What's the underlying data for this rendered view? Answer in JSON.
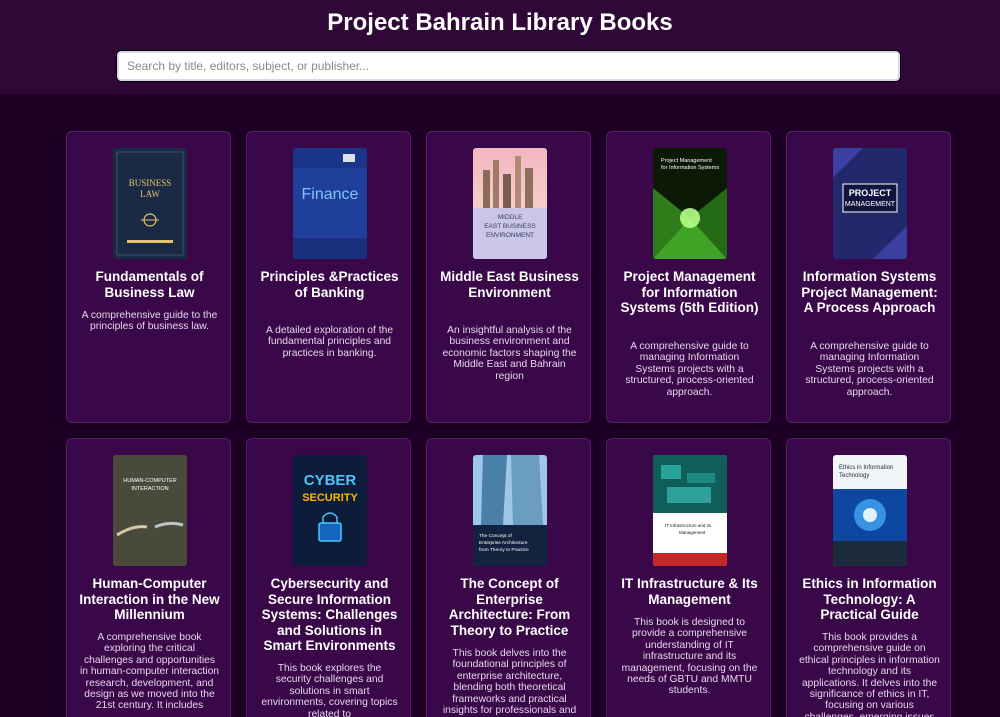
{
  "header": {
    "title": "Project Bahrain Library Books",
    "search_placeholder": "Search by title, editors, subject, or publisher..."
  },
  "books": [
    {
      "title": "Fundamentals of Business Law",
      "description": "A comprehensive guide to the principles of business law.",
      "cover_icon": "business-law-cover",
      "cover_text": [
        "BUSINESS",
        "LAW"
      ]
    },
    {
      "title": "Principles &Practices of Banking",
      "description": "A detailed exploration of the fundamental principles and practices in banking.",
      "cover_icon": "finance-cover",
      "cover_text": [
        "Finance"
      ]
    },
    {
      "title": "Middle East Business Environment",
      "description": "An insightful analysis of the business environment and economic factors shaping the Middle East and Bahrain region",
      "cover_icon": "skyline-cover",
      "cover_text": [
        "MIDDLE",
        "EAST BUSINESS",
        "ENVIRONMENT"
      ]
    },
    {
      "title": "Project Management for Information Systems (5th Edition)",
      "description": "A comprehensive guide to managing Information Systems projects with a structured, process-oriented approach.",
      "cover_icon": "tunnel-cover",
      "cover_text": [
        "Project Management",
        "for Information Systems"
      ]
    },
    {
      "title": "Information Systems Project Management: A Process Approach",
      "description": "A comprehensive guide to managing Information Systems projects with a structured, process-oriented approach.",
      "cover_icon": "project-management-cover",
      "cover_text": [
        "PROJECT",
        "MANAGEMENT"
      ]
    },
    {
      "title": "Human-Computer Interaction in the New Millennium",
      "description": "A comprehensive book exploring the critical challenges and opportunities in human-computer interaction research, development, and design as we moved into the 21st century. It includes",
      "cover_icon": "hands-cover",
      "cover_text": [
        "HUMAN-COMPUTER",
        "INTERACTION"
      ]
    },
    {
      "title": "Cybersecurity and Secure Information Systems: Challenges and Solutions in Smart Environments",
      "description": "This book explores the security challenges and solutions in smart environments, covering topics related to",
      "cover_icon": "cyber-security-cover",
      "cover_text": [
        "CYBER",
        "SECURITY"
      ]
    },
    {
      "title": "The Concept of Enterprise Architecture: From Theory to Practice",
      "description": "This book delves into the foundational principles of enterprise architecture, blending both theoretical frameworks and practical insights for professionals and",
      "cover_icon": "building-cover",
      "cover_text": [
        "The Concept of",
        "Enterprise Architecture",
        "from Theory to Practice"
      ]
    },
    {
      "title": "IT Infrastructure & Its Management",
      "description": "This book is designed to provide a comprehensive understanding of IT infrastructure and its management, focusing on the needs of GBTU and MMTU students.",
      "cover_icon": "circuit-cover",
      "cover_text": [
        "IT Infrastructure and its",
        "Management"
      ]
    },
    {
      "title": "Ethics in Information Technology: A Practical Guide",
      "description": "This book provides a comprehensive guide on ethical principles in information technology and its applications. It delves into the significance of ethics in IT, focusing on various challenges, emerging issues",
      "cover_icon": "ethics-cover",
      "cover_text": [
        "Ethics in Information",
        "Technology"
      ]
    }
  ]
}
